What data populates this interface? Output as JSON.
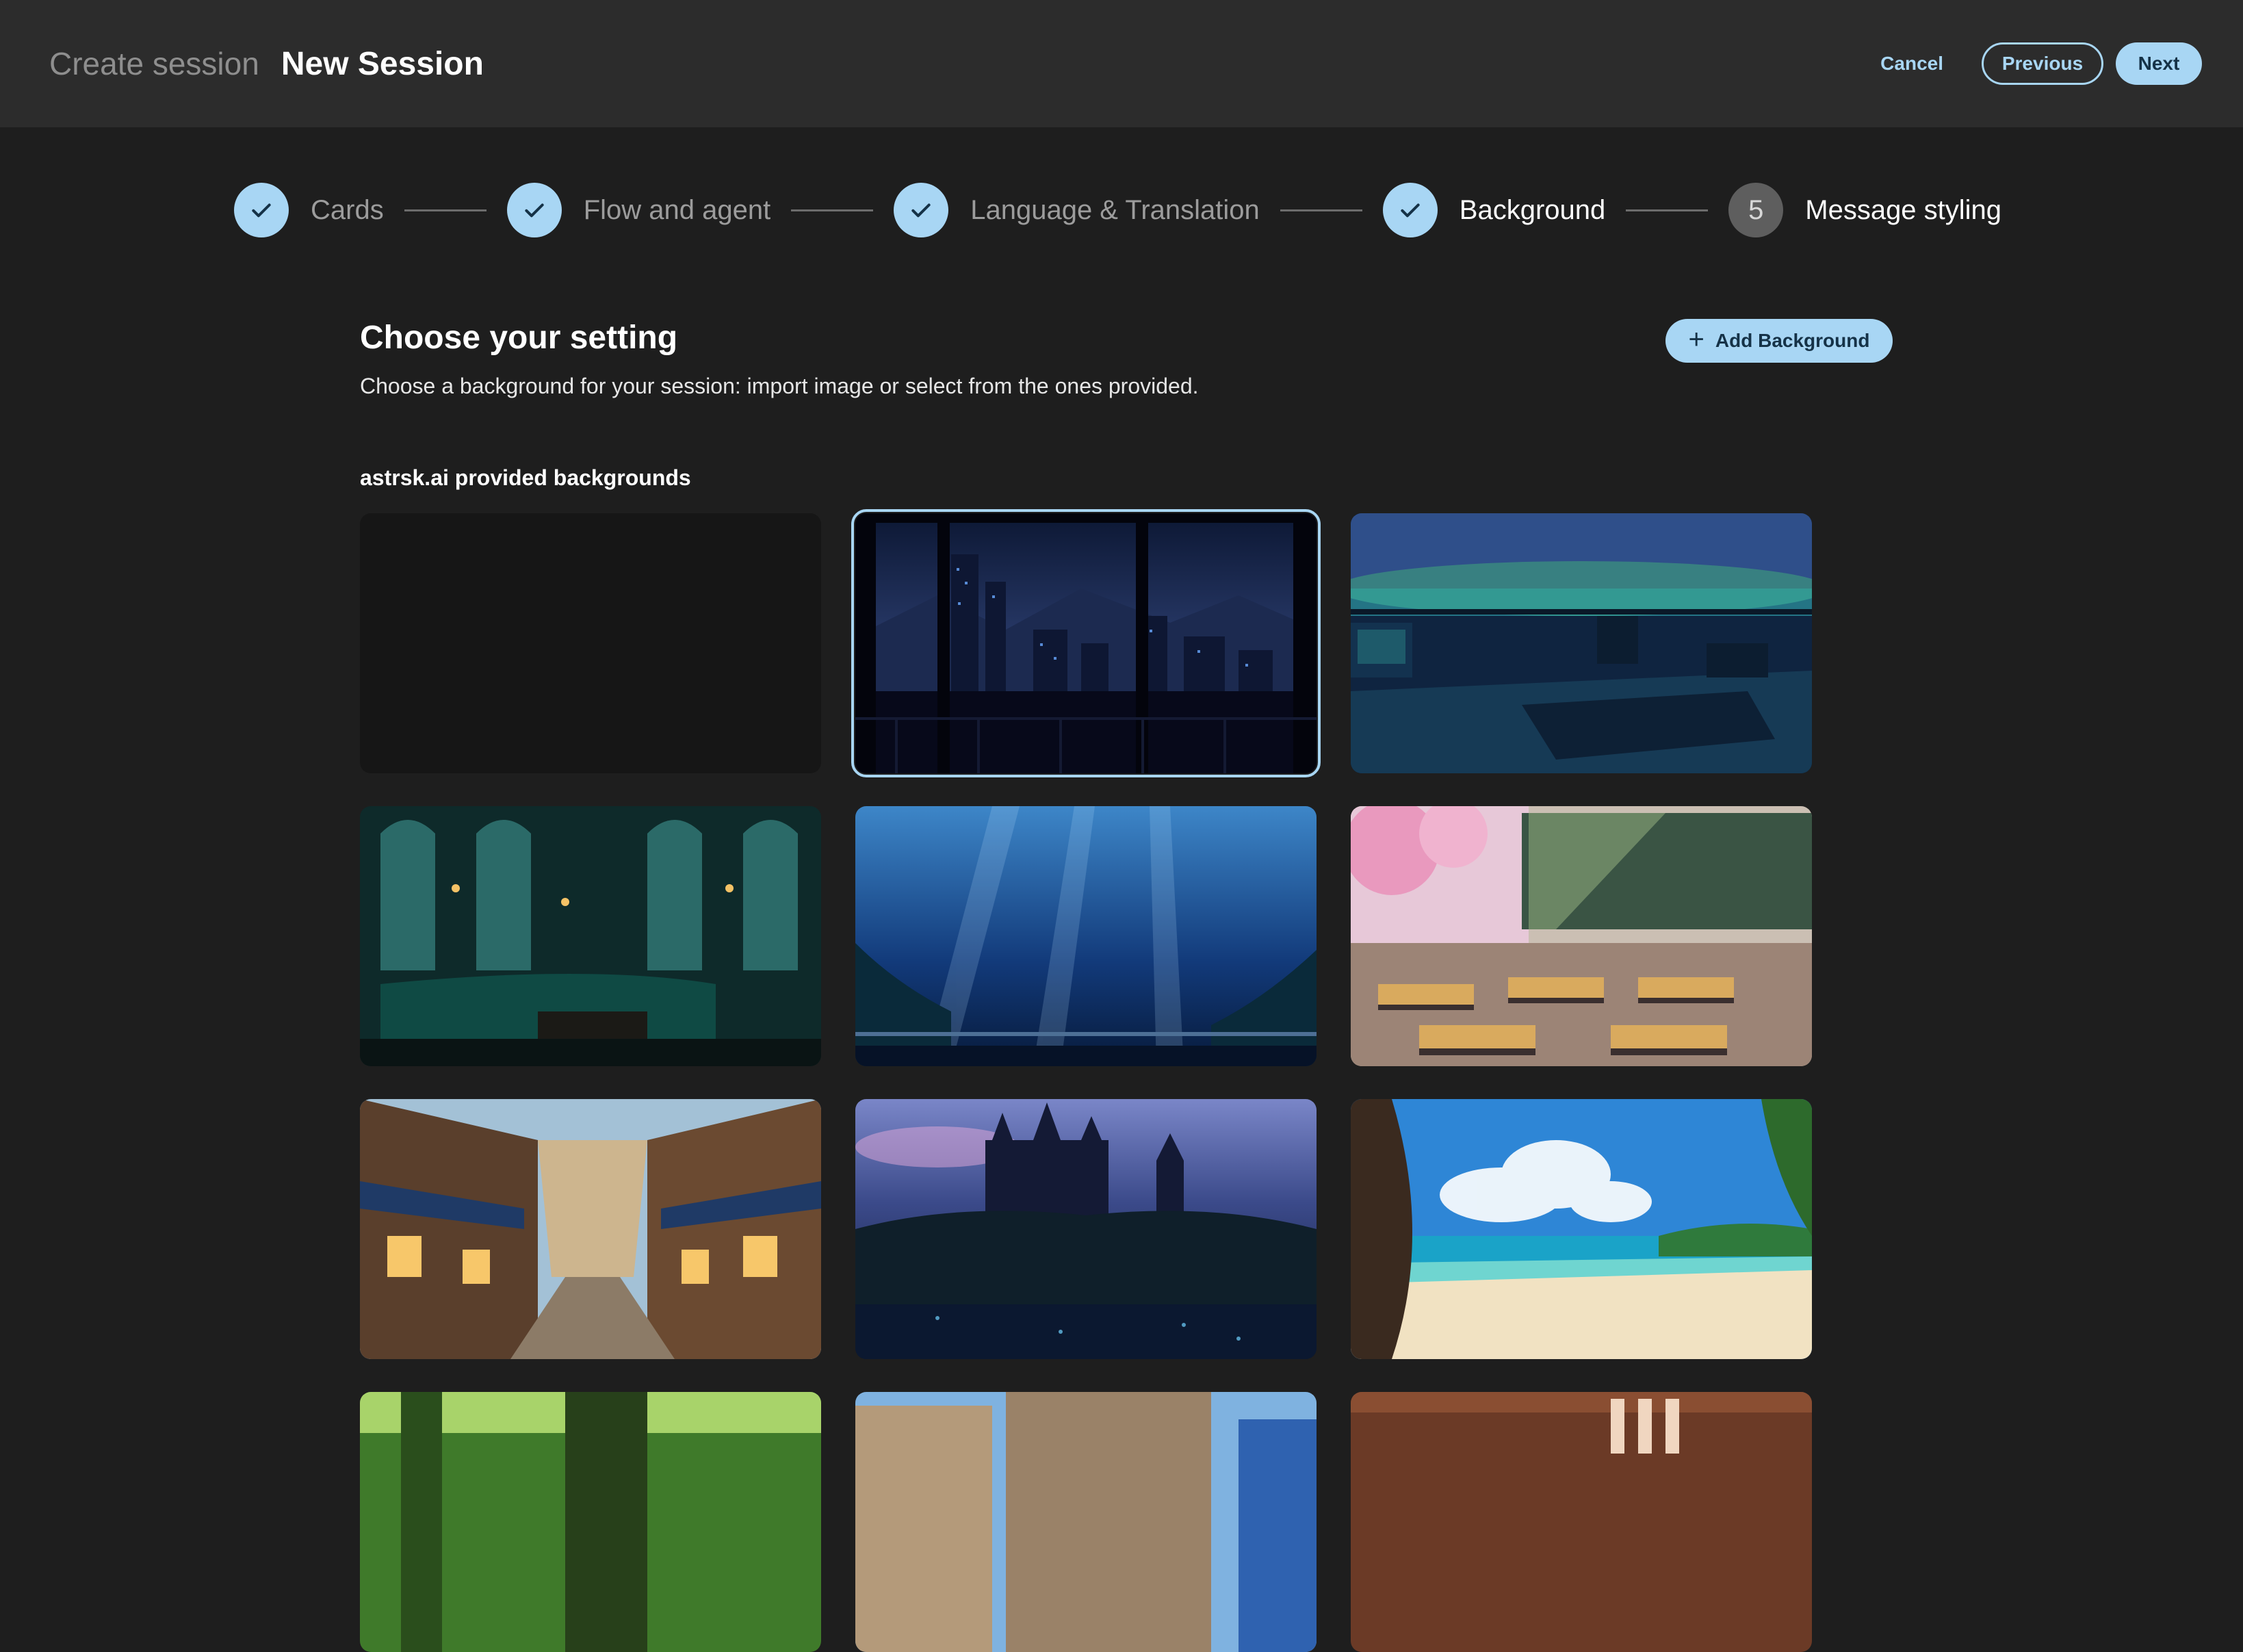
{
  "header": {
    "breadcrumb": "Create session",
    "title": "New Session",
    "cancel_label": "Cancel",
    "previous_label": "Previous",
    "next_label": "Next"
  },
  "stepper": {
    "steps": [
      {
        "label": "Cards",
        "status": "complete"
      },
      {
        "label": "Flow and agent",
        "status": "complete"
      },
      {
        "label": "Language & Translation",
        "status": "complete"
      },
      {
        "label": "Background",
        "status": "current-complete"
      },
      {
        "label": "Message styling",
        "status": "pending",
        "number": "5"
      }
    ]
  },
  "content": {
    "heading": "Choose your setting",
    "description": "Choose a background for your session: import image or select from the ones provided.",
    "add_background_label": "Add Background",
    "section_label": "astrsk.ai provided backgrounds"
  },
  "backgrounds": [
    {
      "name": "none",
      "selected": false
    },
    {
      "name": "night-city-window",
      "selected": true
    },
    {
      "name": "control-room-lake",
      "selected": false
    },
    {
      "name": "gothic-lounge",
      "selected": false
    },
    {
      "name": "underwater-observatory",
      "selected": false
    },
    {
      "name": "sakura-classroom",
      "selected": false
    },
    {
      "name": "medieval-street",
      "selected": false
    },
    {
      "name": "castle-forest-night",
      "selected": false
    },
    {
      "name": "tropical-beach",
      "selected": false
    },
    {
      "name": "jungle-path",
      "selected": false
    },
    {
      "name": "city-rooftops-day",
      "selected": false
    },
    {
      "name": "wooden-interior",
      "selected": false
    }
  ],
  "colors": {
    "accent": "#a8d6f4",
    "header_bg": "#2c2c2c",
    "page_bg": "#1e1e1e"
  }
}
